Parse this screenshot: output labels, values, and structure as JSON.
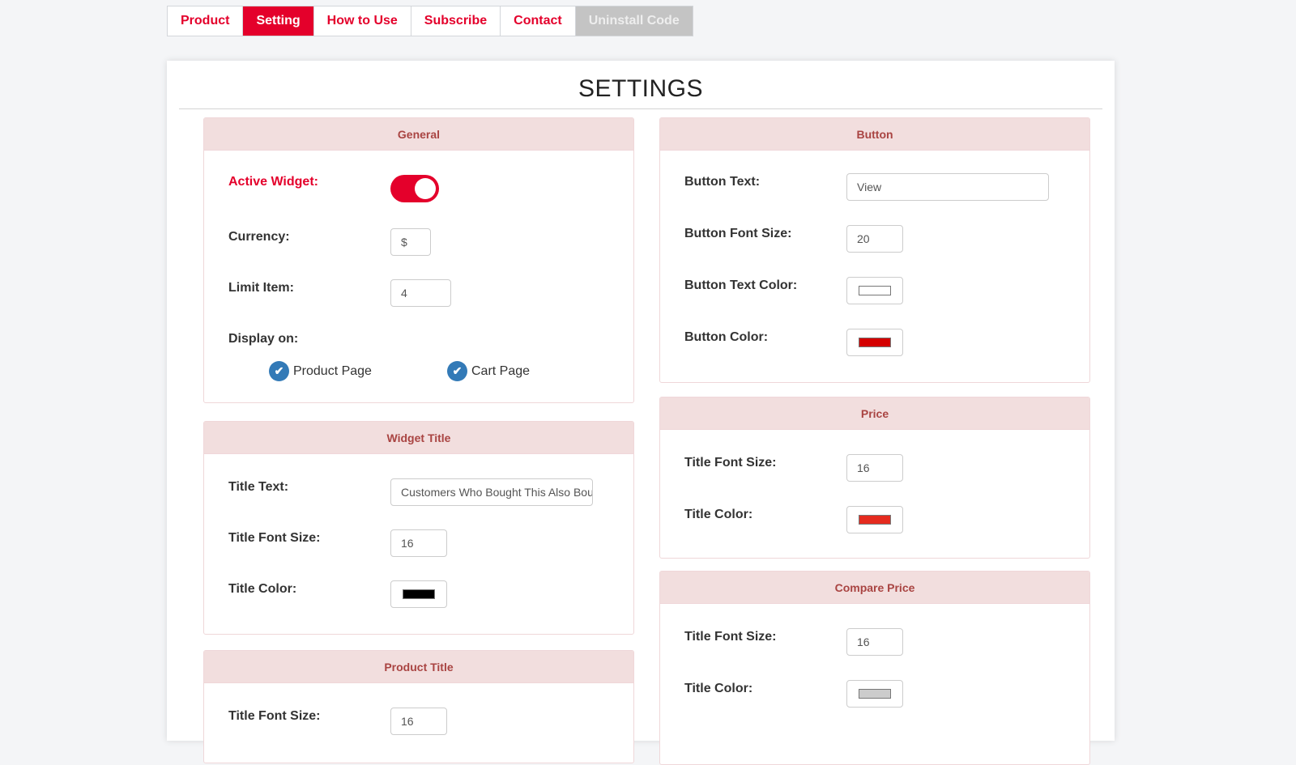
{
  "tabs": [
    {
      "label": "Product",
      "state": "normal"
    },
    {
      "label": "Setting",
      "state": "active"
    },
    {
      "label": "How to Use",
      "state": "normal"
    },
    {
      "label": "Subscribe",
      "state": "normal"
    },
    {
      "label": "Contact",
      "state": "normal"
    },
    {
      "label": "Uninstall Code",
      "state": "disabled"
    }
  ],
  "page_title": "SETTINGS",
  "general": {
    "heading": "General",
    "active_widget": {
      "label": "Active Widget:",
      "enabled": true
    },
    "currency": {
      "label": "Currency:",
      "value": "$"
    },
    "limit_item": {
      "label": "Limit Item:",
      "value": "4"
    },
    "display_on": {
      "label": "Display on:",
      "options": [
        {
          "label": "Product Page",
          "checked": true
        },
        {
          "label": "Cart Page",
          "checked": true
        }
      ]
    }
  },
  "widget_title": {
    "heading": "Widget Title",
    "title_text": {
      "label": "Title Text:",
      "value": "Customers Who Bought This Also Bought"
    },
    "font_size": {
      "label": "Title Font Size:",
      "value": "16"
    },
    "color": {
      "label": "Title Color:",
      "value": "#000000"
    }
  },
  "product_title": {
    "heading": "Product Title",
    "font_size": {
      "label": "Title Font Size:",
      "value": "16"
    }
  },
  "button": {
    "heading": "Button",
    "text": {
      "label": "Button Text:",
      "value": "View"
    },
    "font_size": {
      "label": "Button Font Size:",
      "value": "20"
    },
    "text_color": {
      "label": "Button Text Color:",
      "value": "#ffffff"
    },
    "color": {
      "label": "Button Color:",
      "value": "#d40000"
    }
  },
  "price": {
    "heading": "Price",
    "font_size": {
      "label": "Title Font Size:",
      "value": "16"
    },
    "color": {
      "label": "Title Color:",
      "value": "#e52b1f"
    }
  },
  "compare_price": {
    "heading": "Compare Price",
    "font_size": {
      "label": "Title Font Size:",
      "value": "16"
    },
    "color": {
      "label": "Title Color:",
      "value": "#cccccc"
    }
  },
  "icons": {
    "check": "✔"
  }
}
